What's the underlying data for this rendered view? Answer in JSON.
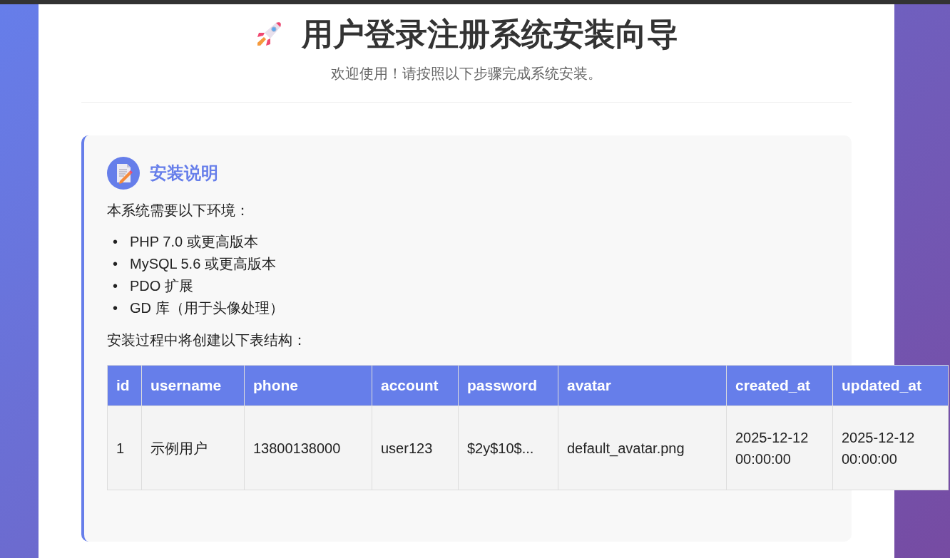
{
  "header": {
    "title": "用户登录注册系统安装向导",
    "subtitle": "欢迎使用！请按照以下步骤完成系统安装。"
  },
  "card": {
    "title": "安装说明",
    "intro": "本系统需要以下环境：",
    "requirements": [
      {
        "marker": "•",
        "text": "PHP 7.0 或更高版本"
      },
      {
        "marker": "•",
        "text": "MySQL 5.6 或更高版本"
      },
      {
        "marker": "•",
        "text": "PDO 扩展"
      },
      {
        "marker": "•",
        "text": "GD 库（用于头像处理）"
      }
    ],
    "table_intro": "安装过程中将创建以下表结构：",
    "table": {
      "columns": [
        "id",
        "username",
        "phone",
        "account",
        "password",
        "avatar",
        "created_at",
        "updated_at"
      ],
      "rows": [
        [
          "1",
          "示例用户",
          "13800138000",
          "user123",
          "$2y$10$...",
          "default_avatar.png",
          "2025-12-12 00:00:00",
          "2025-12-12 00:00:00"
        ]
      ]
    }
  }
}
